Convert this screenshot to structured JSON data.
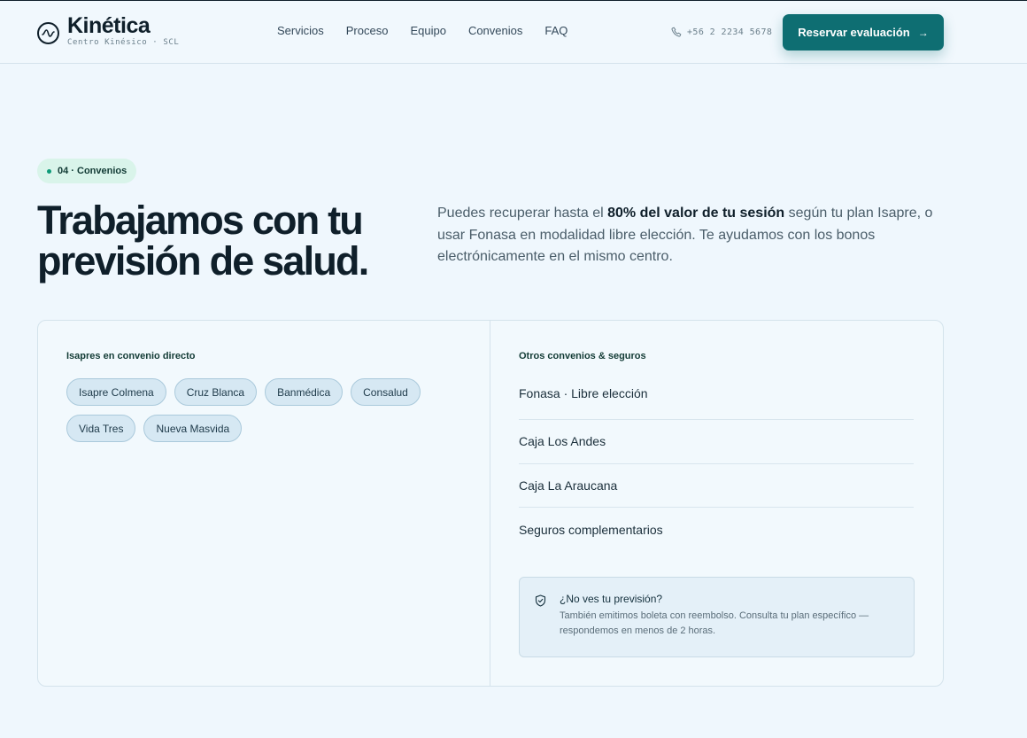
{
  "header": {
    "brand_name": "Kinética",
    "brand_sub": "Centro Kinésico · SCL",
    "nav": [
      "Servicios",
      "Proceso",
      "Equipo",
      "Convenios",
      "FAQ"
    ],
    "phone": "+56 2 2234 5678",
    "cta_label": "Reservar evaluación",
    "cta_arrow": "→"
  },
  "section": {
    "badge": "04 · Convenios",
    "title": "Trabajamos con tu previsión de salud.",
    "intro_pre": "Puedes recuperar hasta el ",
    "intro_strong": "80% del valor de tu sesión",
    "intro_post": " según tu plan Isapre, o usar Fonasa en modalidad libre elección. Te ayudamos con los bonos electrónicamente en el mismo centro."
  },
  "isapres": {
    "title": "Isapres en convenio directo",
    "chips": [
      "Isapre Colmena",
      "Cruz Blanca",
      "Banmédica",
      "Consalud",
      "Vida Tres",
      "Nueva Masvida"
    ]
  },
  "otros": {
    "title": "Otros convenios & seguros",
    "items": [
      "Fonasa · Libre elección",
      "Caja Los Andes",
      "Caja La Araucana",
      "Seguros complementarios"
    ]
  },
  "note": {
    "title": "¿No ves tu previsión?",
    "body": "También emitimos boleta con reembolso. Consulta tu plan específico — respondemos en menos de 2 horas."
  },
  "icons": {
    "brand": "pulse-icon",
    "phone": "phone-icon",
    "note": "shield-check-icon"
  },
  "colors": {
    "accent": "#0e6e72",
    "badge_bg": "#d9f4ea",
    "chip_bg": "#d6e8f3",
    "page_bg": "#eff7fd"
  }
}
